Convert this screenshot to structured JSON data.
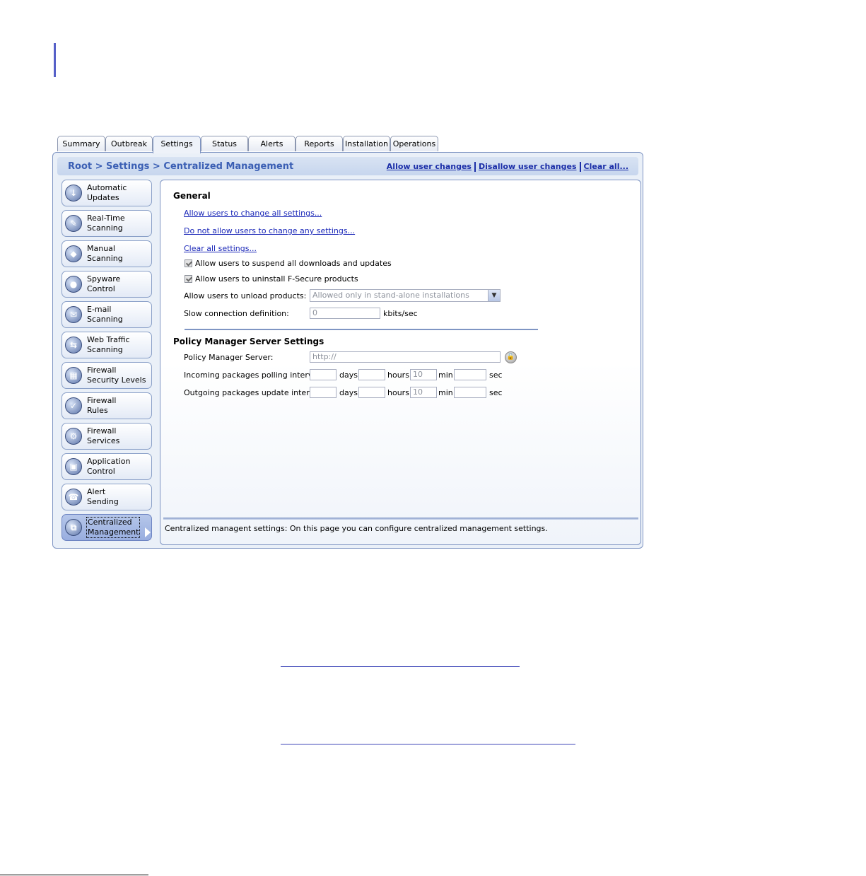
{
  "tabs": [
    {
      "label": "Summary"
    },
    {
      "label": "Outbreak"
    },
    {
      "label": "Settings"
    },
    {
      "label": "Status"
    },
    {
      "label": "Alerts"
    },
    {
      "label": "Reports"
    },
    {
      "label": "Installation"
    },
    {
      "label": "Operations"
    }
  ],
  "active_tab": "Settings",
  "breadcrumb": "Root > Settings > Centralized Management",
  "toolbar": {
    "allow_label": "Allow user changes",
    "disallow_label": "Disallow user changes",
    "clear_label": "Clear all..."
  },
  "sidebar": {
    "items": [
      {
        "line1": "Automatic",
        "line2": "Updates",
        "icon": "update-icon"
      },
      {
        "line1": "Real-Time",
        "line2": "Scanning",
        "icon": "realtime-scan-icon"
      },
      {
        "line1": "Manual",
        "line2": "Scanning",
        "icon": "manual-scan-icon"
      },
      {
        "line1": "Spyware",
        "line2": "Control",
        "icon": "spyware-icon"
      },
      {
        "line1": "E-mail",
        "line2": "Scanning",
        "icon": "email-icon"
      },
      {
        "line1": "Web Traffic",
        "line2": "Scanning",
        "icon": "web-traffic-icon"
      },
      {
        "line1": "Firewall",
        "line2": "Security Levels",
        "icon": "firewall-levels-icon"
      },
      {
        "line1": "Firewall",
        "line2": "Rules",
        "icon": "firewall-rules-icon"
      },
      {
        "line1": "Firewall",
        "line2": "Services",
        "icon": "firewall-services-icon"
      },
      {
        "line1": "Application",
        "line2": "Control",
        "icon": "application-icon"
      },
      {
        "line1": "Alert",
        "line2": "Sending",
        "icon": "alert-icon"
      },
      {
        "line1": "Centralized",
        "line2": "Management",
        "icon": "centralized-icon"
      }
    ],
    "active_index": 11
  },
  "general": {
    "title": "General",
    "link_allow_all": "Allow users to change all settings...",
    "link_disallow_all": "Do not allow users to change any settings...",
    "link_clear_all": "Clear all settings...",
    "cb_suspend": "Allow users to suspend all downloads and updates",
    "cb_uninstall": "Allow users to uninstall F-Secure products",
    "unload_label": "Allow users to unload products:",
    "unload_value": "Allowed only in stand-alone installations",
    "slow_label": "Slow connection definition:",
    "slow_value": "0",
    "slow_unit": "kbits/sec"
  },
  "pms": {
    "title": "Policy Manager Server Settings",
    "server_label": "Policy Manager Server:",
    "server_value": "http://",
    "incoming_label": "Incoming packages polling interval:",
    "outgoing_label": "Outgoing packages update interval:",
    "incoming": {
      "days": "",
      "hours": "",
      "min": "10",
      "sec": ""
    },
    "outgoing": {
      "days": "",
      "hours": "",
      "min": "10",
      "sec": ""
    },
    "unit_days": "days",
    "unit_hours": "hours",
    "unit_min": "min",
    "unit_sec": "sec"
  },
  "status_text": "Centralized managent settings: On this page you can configure centralized management settings."
}
